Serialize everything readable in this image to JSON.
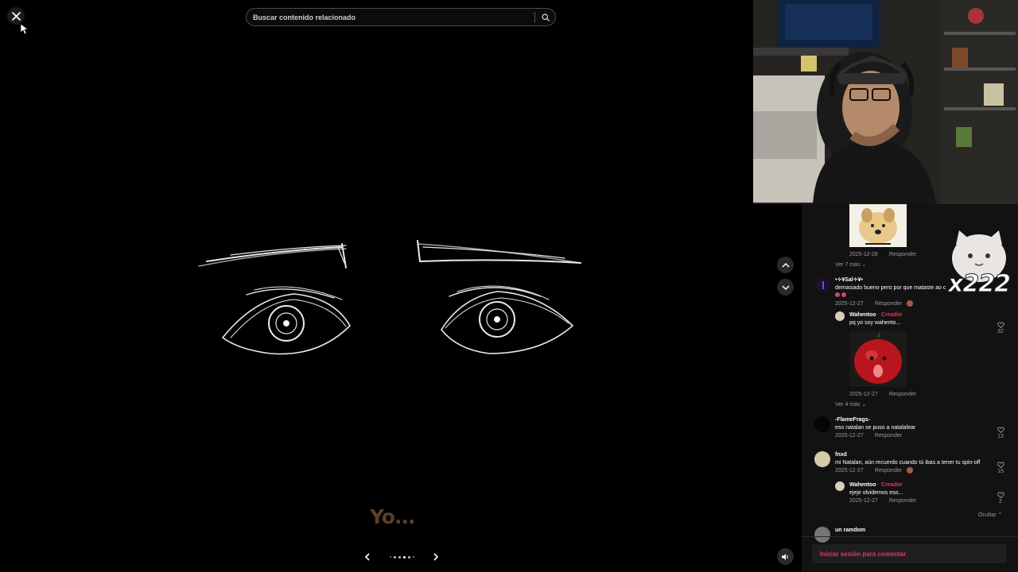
{
  "search": {
    "placeholder": "Buscar contenido relacionado"
  },
  "video": {
    "caption": "Yo...",
    "pager_dots": 5
  },
  "sticker": {
    "overlay_text": "x222"
  },
  "comments": {
    "top_reply": {
      "date": "2025-12-28",
      "reply_label": "Responder"
    },
    "view_more_1": "Ver 7 más",
    "c1": {
      "username": "•✧¥Sal✧¥•",
      "text": "demasiado bueno pero por que mataste ao c",
      "date": "2025-12-27",
      "reply_label": "Responder",
      "reply": {
        "username": "Wahentoo",
        "creator_label": "· Creador",
        "text": "pq yo soy wahento...",
        "likes": "32",
        "date": "2025-12-27",
        "reply_label": "Responder"
      }
    },
    "view_more_2": "Ver 4 más",
    "c2": {
      "username": "-FlameFrags-",
      "text": "eso natalan se puso a natalalear",
      "date": "2025-12-27",
      "reply_label": "Responder",
      "likes": "13"
    },
    "c3": {
      "username": "fnxd",
      "text": "mi Natalan, aún recuerdo cuando tú ibas a tener tu spin-off",
      "date": "2025-12-27",
      "reply_label": "Responder",
      "likes": "15",
      "reply": {
        "username": "Wahentoo",
        "creator_label": "· Creador",
        "text": "ejeje olvidemos eso...",
        "likes": "2",
        "date": "2025-12-27",
        "reply_label": "Responder"
      }
    },
    "hide_label": "Ocultar",
    "c4": {
      "username": "un ramdom"
    }
  },
  "login": {
    "label": "Iniciar sesión para comentar"
  },
  "colors": {
    "accent": "#fe2c55",
    "panel_bg": "#121212",
    "stage_bg": "#000000"
  }
}
